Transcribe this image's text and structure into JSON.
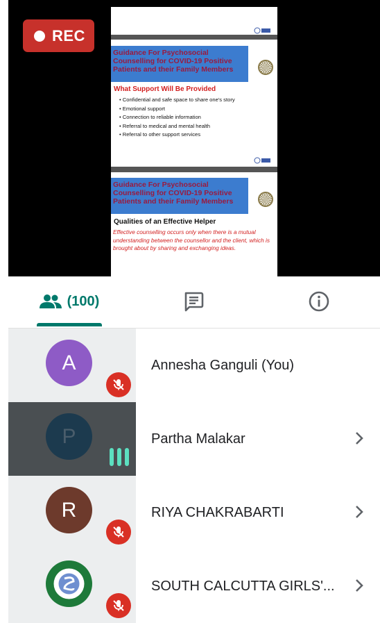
{
  "video": {
    "rec_label": "REC",
    "slide1": {
      "title": "Guidance For Psychosocial Counselling for COVID-19 Positive Patients and their Family Members",
      "section": "What Support Will Be Provided",
      "bullets": [
        "Confidential and safe space to share one's story",
        "Emotional support",
        "Connection to reliable information",
        "Referral to medical and mental health",
        "Referral to other support services"
      ]
    },
    "slide2": {
      "title": "Guidance For Psychosocial Counselling for COVID-19 Positive Patients and their Family Members",
      "section": "Qualities of an Effective Helper",
      "body": "Effective counselling occurs only when there is a mutual understanding between the counsellor and the client, which is brought about by sharing and exchanging ideas."
    }
  },
  "tabs": {
    "people_count": "(100)",
    "accent_color": "#00796b"
  },
  "participants": [
    {
      "initial": "A",
      "name": "Annesha Ganguli (You)",
      "avatar_color": "#8e5bc6",
      "muted": true
    },
    {
      "initial": "P",
      "name": "Partha Malakar",
      "avatar_color": "#1c3a4e",
      "speaking": true
    },
    {
      "initial": "R",
      "name": "RIYA CHAKRABARTI",
      "avatar_color": "#6d3a2c",
      "muted": true
    },
    {
      "initial": "",
      "name": "SOUTH CALCUTTA GIRLS'...",
      "avatar_color": "#1e7a3a",
      "muted": true
    }
  ]
}
